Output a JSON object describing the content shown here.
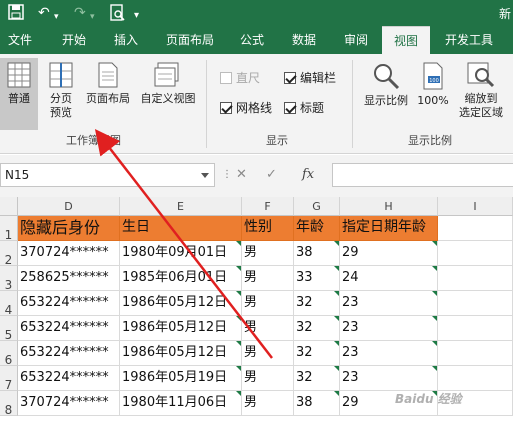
{
  "window": {
    "title_partial": "新"
  },
  "tabs": [
    {
      "label": "文件"
    },
    {
      "label": "开始"
    },
    {
      "label": "插入"
    },
    {
      "label": "页面布局"
    },
    {
      "label": "公式"
    },
    {
      "label": "数据"
    },
    {
      "label": "审阅"
    },
    {
      "label": "视图"
    },
    {
      "label": "开发工具"
    }
  ],
  "active_tab": "视图",
  "ribbon": {
    "workbook_views": {
      "group_label": "工作簿视图",
      "normal": "普通",
      "page_break_line1": "分页",
      "page_break_line2": "预览",
      "page_layout": "页面布局",
      "custom_views": "自定义视图"
    },
    "show": {
      "group_label": "显示",
      "ruler": "直尺",
      "formula_bar": "编辑栏",
      "gridlines": "网格线",
      "headings": "标题"
    },
    "zoom": {
      "group_label": "显示比例",
      "zoom": "显示比例",
      "hundred": "100%",
      "selection_line1": "缩放到",
      "selection_line2": "选定区域"
    }
  },
  "formula_bar": {
    "name_box": "N15",
    "cancel": "✕",
    "enter": "✓",
    "fx": "fx"
  },
  "sheet": {
    "columns": [
      "D",
      "E",
      "F",
      "G",
      "H",
      "I"
    ],
    "rows": [
      "1",
      "2",
      "3",
      "4",
      "5",
      "6",
      "7",
      "8"
    ],
    "header": [
      "隐藏后身份",
      "生日",
      "性别",
      "年龄",
      "指定日期年龄"
    ],
    "data": [
      [
        "370724******",
        "1980年09月01日",
        "男",
        "38",
        "29"
      ],
      [
        "258625******",
        "1985年06月01日",
        "男",
        "33",
        "24"
      ],
      [
        "653224******",
        "1986年05月12日",
        "男",
        "32",
        "23"
      ],
      [
        "653224******",
        "1986年05月12日",
        "男",
        "32",
        "23"
      ],
      [
        "653224******",
        "1986年05月12日",
        "男",
        "32",
        "23"
      ],
      [
        "653224******",
        "1986年05月19日",
        "男",
        "32",
        "23"
      ],
      [
        "370724******",
        "1980年11月06日",
        "男",
        "38",
        "29"
      ]
    ]
  },
  "colors": {
    "brand_green": "#217346",
    "header_fill": "#ed7d31",
    "arrow": "#e02020"
  },
  "watermark": "Baidu 经验"
}
